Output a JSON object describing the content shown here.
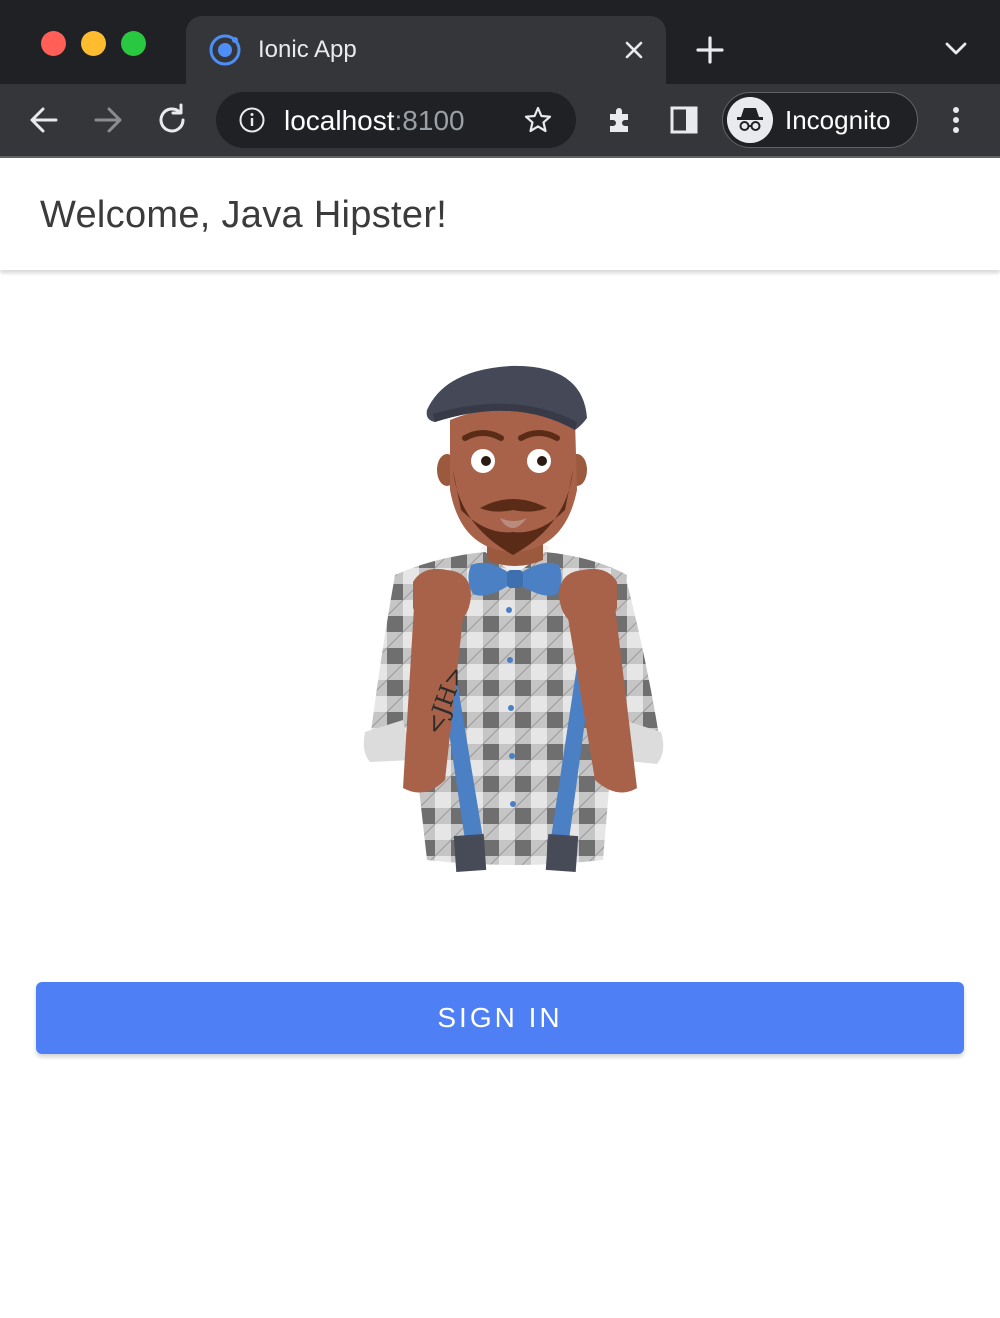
{
  "browser": {
    "tab_title": "Ionic App",
    "tab_close_icon": "close-icon",
    "url_host": "localhost",
    "url_port": ":8100",
    "profile_label": "Incognito"
  },
  "header": {
    "title": "Welcome, Java Hipster!"
  },
  "main": {
    "illustration": "jhipster-hipster-illustration",
    "signin_label": "SIGN IN"
  },
  "colors": {
    "accent": "#4e7ff5",
    "chrome_dark": "#202124",
    "chrome_toolbar": "#35363a"
  }
}
